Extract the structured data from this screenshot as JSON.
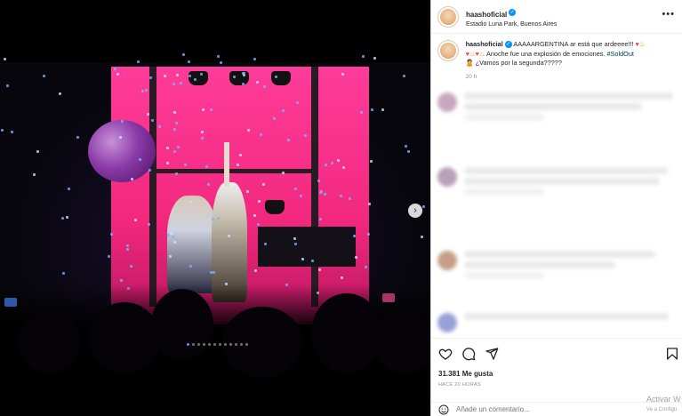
{
  "post": {
    "username": "haashoficial",
    "location": "Estadio Luna Park, Buenos Aires",
    "caption": {
      "username": "haashoficial",
      "part1": "AAAAARGENTINA",
      "part2": "ar está que ardeeee!!!",
      "part3": "Anoche fue una explosión de emociones.",
      "hashtag": "#SoldOut",
      "part4": "¿Vamos por la segunda?????",
      "time": "20 h"
    },
    "likes": "31.381 Me gusta",
    "posted_ago": "HACE 20 HORAS",
    "comment_placeholder": "Añade un comentario..."
  },
  "carousel": {
    "slides": 12,
    "active_index": 0,
    "next_label": "›"
  },
  "overlay": {
    "activate": "Activar W",
    "activate_sub": "Ve a Configu"
  },
  "colors": {
    "verified": "#0095f6",
    "hashtag": "#00376b",
    "stage": "#f2287e"
  },
  "icons": [
    "heart-icon",
    "comment-icon",
    "share-icon",
    "bookmark-icon",
    "emoji-icon",
    "more-icon",
    "verified-icon",
    "chevron-right-icon"
  ]
}
